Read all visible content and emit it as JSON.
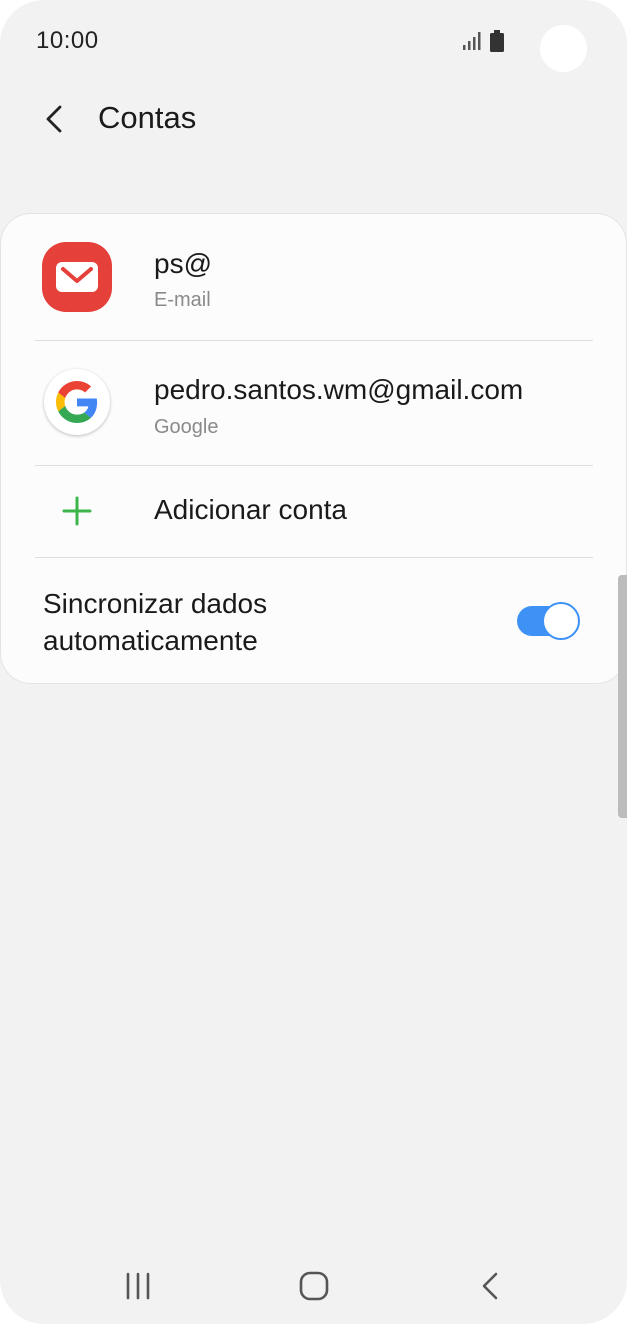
{
  "status_bar": {
    "time": "10:00"
  },
  "header": {
    "title": "Contas"
  },
  "accounts": [
    {
      "name": "ps@",
      "type": "E-mail",
      "icon": "email-app-icon"
    },
    {
      "name": "pedro.santos.wm@gmail.com",
      "type": "Google",
      "icon": "google-icon"
    }
  ],
  "add_account": {
    "label": "Adicionar conta"
  },
  "sync": {
    "label": "Sincronizar dados automaticamente",
    "enabled": true
  },
  "colors": {
    "background": "#f2f2f2",
    "card": "#fcfcfc",
    "toggle_on": "#3e91f5",
    "email_icon": "#e5403a",
    "plus_icon": "#3cb54a",
    "secondary_text": "#8a8a8a"
  }
}
